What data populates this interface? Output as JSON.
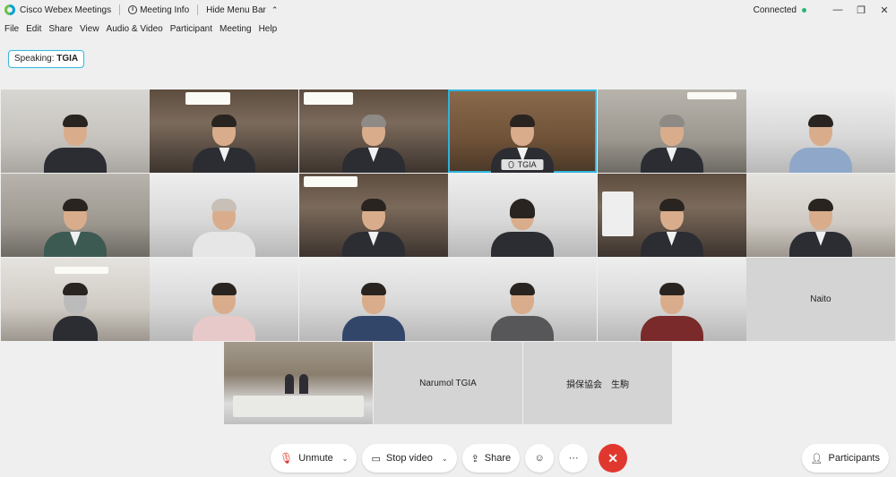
{
  "titlebar": {
    "app_name": "Cisco Webex Meetings",
    "meeting_info": "Meeting Info",
    "hide_menu": "Hide Menu Bar",
    "status": "Connected",
    "status_color": "#2bb673"
  },
  "menu": [
    "File",
    "Edit",
    "Share",
    "View",
    "Audio & Video",
    "Participant",
    "Meeting",
    "Help"
  ],
  "speaking": {
    "prefix": "Speaking:",
    "name": "TGIA"
  },
  "tiles": [
    {
      "type": "video",
      "label": ""
    },
    {
      "type": "video",
      "label": ""
    },
    {
      "type": "video",
      "label": ""
    },
    {
      "type": "video",
      "label": "TGIA",
      "active": true
    },
    {
      "type": "video",
      "label": ""
    },
    {
      "type": "video",
      "label": ""
    },
    {
      "type": "video",
      "label": ""
    },
    {
      "type": "video",
      "label": ""
    },
    {
      "type": "video",
      "label": ""
    },
    {
      "type": "video",
      "label": ""
    },
    {
      "type": "video",
      "label": ""
    },
    {
      "type": "video",
      "label": ""
    },
    {
      "type": "video",
      "label": ""
    },
    {
      "type": "video",
      "label": ""
    },
    {
      "type": "video",
      "label": ""
    },
    {
      "type": "video",
      "label": ""
    },
    {
      "type": "video",
      "label": ""
    },
    {
      "type": "name",
      "label": "Naito"
    }
  ],
  "bottom_row": [
    "",
    "Narumol TGIA",
    "損保協会　生駒"
  ],
  "controls": {
    "unmute": "Unmute",
    "stop_video": "Stop video",
    "share": "Share",
    "participants": "Participants",
    "end_color": "#e0382e"
  }
}
